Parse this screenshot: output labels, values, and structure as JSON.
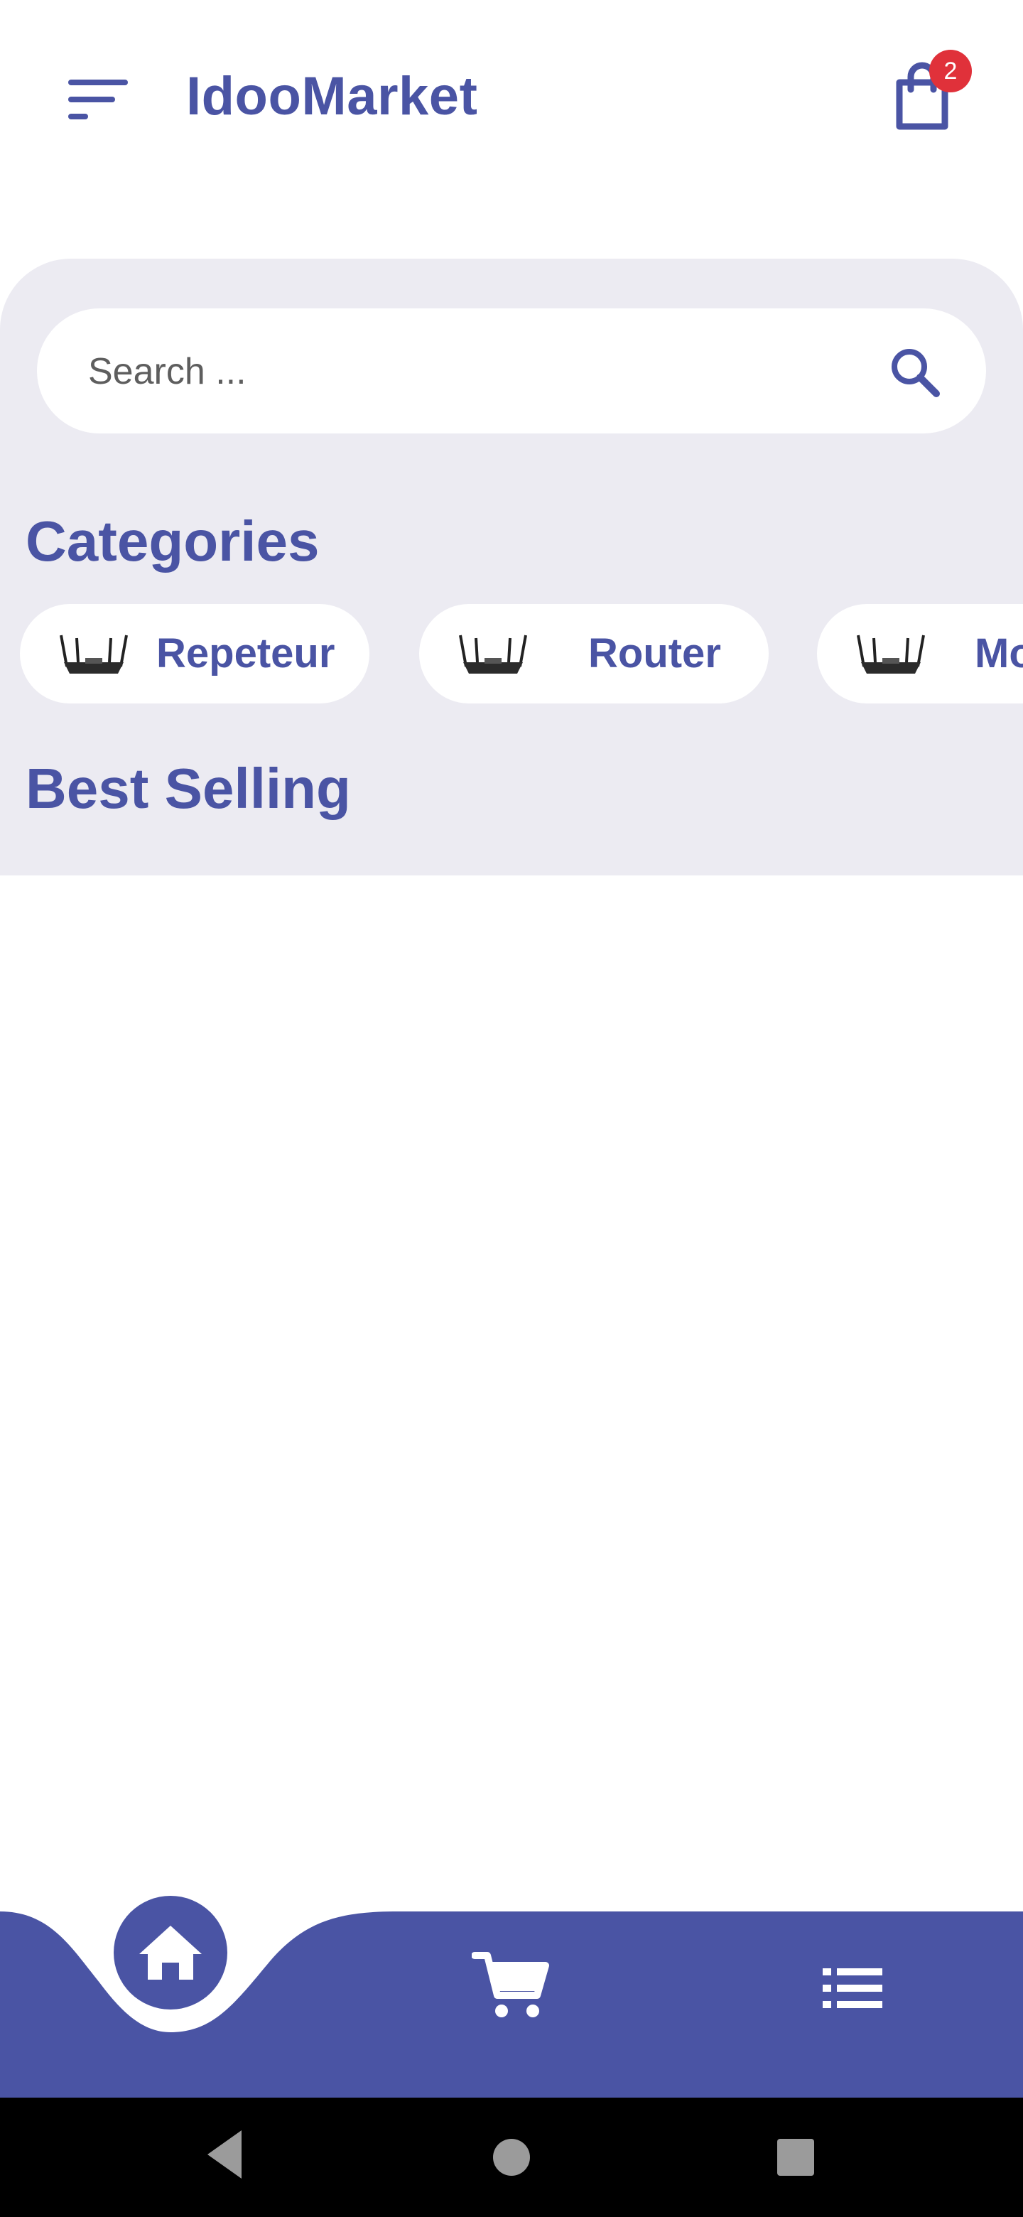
{
  "header": {
    "menu_icon": "menu-sort-icon",
    "app_title": "IdooMarket",
    "cart_icon": "shopping-bag-icon",
    "cart_badge": "2"
  },
  "search": {
    "placeholder": "Search ...",
    "icon": "search-icon"
  },
  "categories": {
    "title": "Categories",
    "items": [
      {
        "label": "Repeteur",
        "icon": "router-image"
      },
      {
        "label": "Router",
        "icon": "router-image"
      },
      {
        "label": "Mo",
        "icon": "router-image"
      }
    ]
  },
  "best_selling": {
    "title": "Best Selling"
  },
  "bottom_nav": {
    "items": [
      {
        "name": "home",
        "icon": "home-icon",
        "active": true
      },
      {
        "name": "cart",
        "icon": "cart-icon",
        "active": false
      },
      {
        "name": "list",
        "icon": "list-icon",
        "active": false
      }
    ]
  },
  "system_nav": [
    "back-icon",
    "home-circle-icon",
    "recents-square-icon"
  ],
  "colors": {
    "accent": "#4a54a4",
    "panel_bg": "#ecebf2",
    "badge": "#e0313a"
  }
}
